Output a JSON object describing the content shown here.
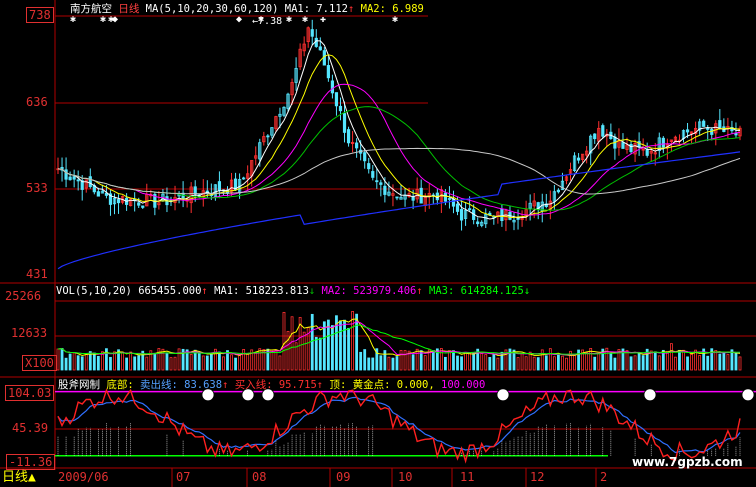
{
  "chart_data": [
    {
      "type": "candlestick",
      "panel": "price",
      "title": "南方航空",
      "period_label": "日线",
      "indicator": "MA(5,10,20,30,60,120)",
      "ma1": "MA1: 7.112",
      "ma2": "MA2: 6.989",
      "ylim": [
        4.31,
        7.38
      ],
      "y_ticks": [
        "738",
        "636",
        "533",
        "431"
      ],
      "annotation": "7.38",
      "series": [
        {
          "name": "MA1",
          "color": "#ffffff"
        },
        {
          "name": "MA2",
          "color": "#ffff00"
        }
      ]
    },
    {
      "type": "bar",
      "panel": "volume",
      "indicator": "VOL(5,10,20)",
      "vol_value": "665455.000",
      "ma1": "MA1: 518223.813",
      "ma2": "MA2: 523979.406",
      "ma3": "MA3: 614284.125",
      "y_ticks": [
        "25266",
        "12633"
      ],
      "unit": "X100",
      "ylim": [
        0,
        25266
      ]
    },
    {
      "type": "line",
      "panel": "oscillator",
      "indicator": "股斧网制",
      "bottom_label": "底部:",
      "sell_line": "卖出线: 83.638",
      "buy_line": "买入线: 95.715",
      "top_label": "顶:",
      "golden_point": "黄金点: 0.000,",
      "hundred": "100.000",
      "ylim": [
        -11.36,
        104.03
      ],
      "y_ticks": [
        "104.03",
        "45.39",
        "-11.36"
      ]
    }
  ],
  "x_axis": {
    "labels": [
      "2009/06",
      "07",
      "08",
      "09",
      "10",
      "11",
      "12",
      "2"
    ]
  },
  "status": {
    "period": "日线",
    "marker": "▲"
  },
  "watermark": "www.7gpzb.com",
  "colors": {
    "up": "#ff3030",
    "up_cyan": "#55e6ff",
    "down": "#55e6ff",
    "grid": "#b00000",
    "ma5": "#ffffff",
    "ma10": "#ffff00",
    "ma20": "#ff00ff",
    "ma30": "#00c000",
    "ma60": "#c8c8c8",
    "ma120": "#2030ff"
  }
}
